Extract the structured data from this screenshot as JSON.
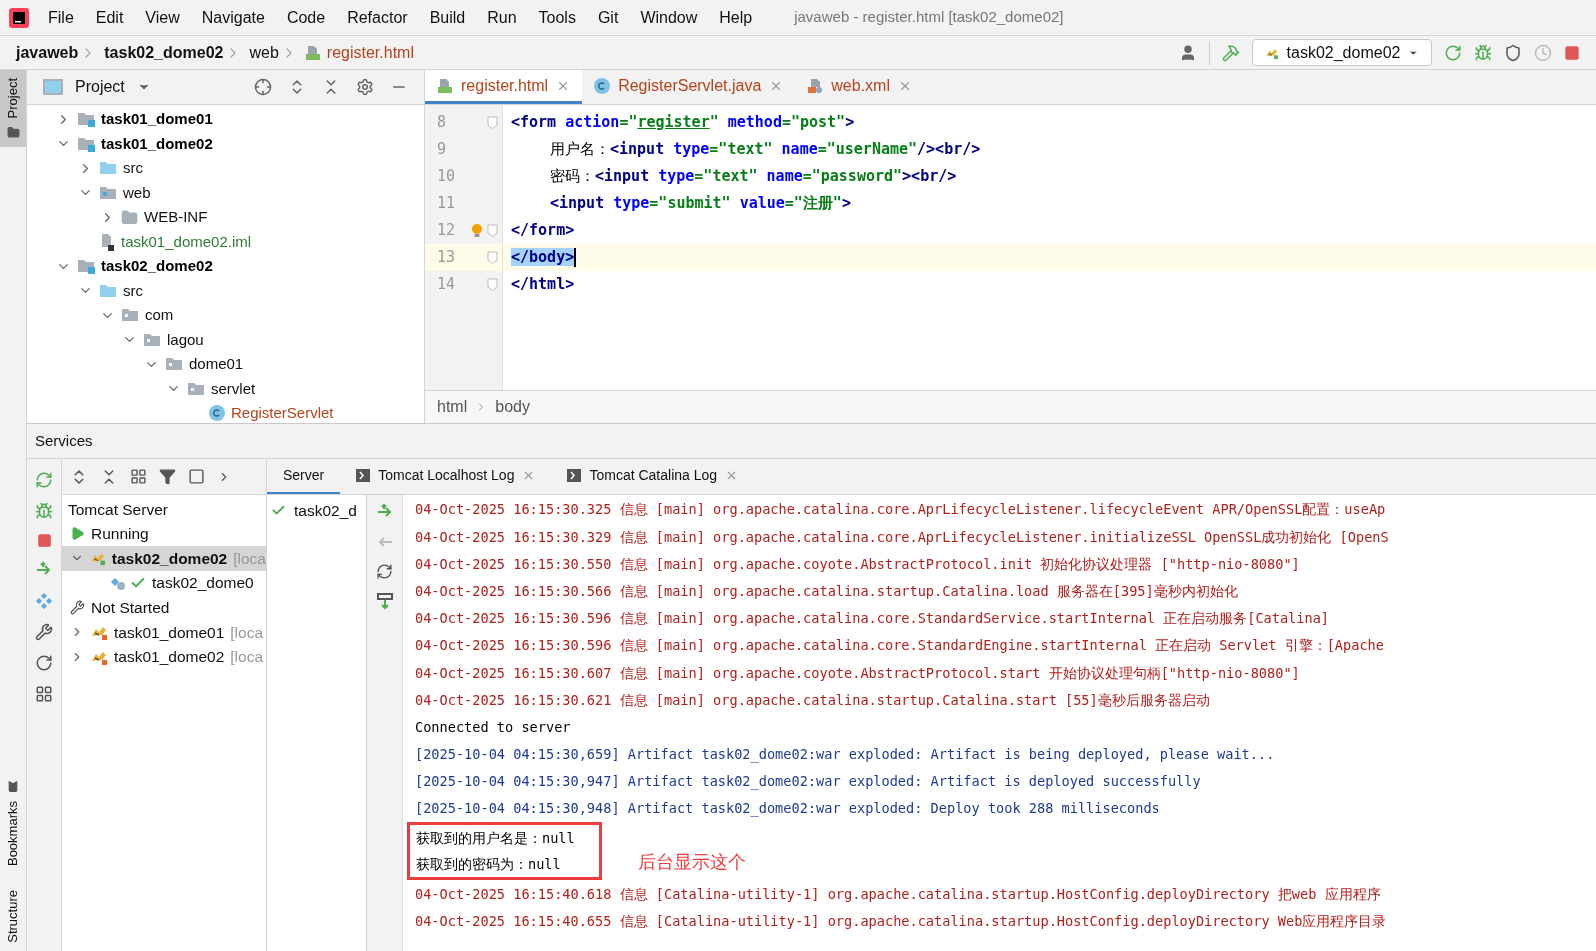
{
  "menu": [
    "File",
    "Edit",
    "View",
    "Navigate",
    "Code",
    "Refactor",
    "Build",
    "Run",
    "Tools",
    "Git",
    "Window",
    "Help"
  ],
  "window": {
    "title": "javaweb - register.html [task02_dome02]"
  },
  "breadcrumb": [
    {
      "label": "javaweb",
      "bold": true
    },
    {
      "label": "task02_dome02",
      "bold": true
    },
    {
      "label": "web",
      "bold": false
    },
    {
      "label": "register.html",
      "bold": false,
      "file": true
    }
  ],
  "run_config": {
    "label": "task02_dome02"
  },
  "side_tabs": {
    "top": "Project",
    "bottom": [
      "Bookmarks",
      "Structure"
    ]
  },
  "project": {
    "title": "Project",
    "tree": [
      {
        "label": "task01_dome01",
        "kind": "module",
        "bold": true,
        "expanded": false
      },
      {
        "label": "task01_dome02",
        "kind": "module",
        "bold": true,
        "expanded": true,
        "children": [
          {
            "label": "src",
            "kind": "source",
            "expanded": false
          },
          {
            "label": "web",
            "kind": "web",
            "expanded": true,
            "children": [
              {
                "label": "WEB-INF",
                "kind": "folder",
                "expanded": false
              }
            ]
          },
          {
            "label": "task01_dome02.iml",
            "kind": "iml",
            "color": "#2e7d32"
          }
        ]
      },
      {
        "label": "task02_dome02",
        "kind": "module",
        "bold": true,
        "expanded": true,
        "children": [
          {
            "label": "src",
            "kind": "source",
            "expanded": true,
            "children": [
              {
                "label": "com",
                "kind": "package",
                "expanded": true,
                "children": [
                  {
                    "label": "lagou",
                    "kind": "package",
                    "expanded": true,
                    "children": [
                      {
                        "label": "dome01",
                        "kind": "package",
                        "expanded": true,
                        "children": [
                          {
                            "label": "servlet",
                            "kind": "package",
                            "expanded": true,
                            "children": [
                              {
                                "label": "RegisterServlet",
                                "kind": "class",
                                "color": "#b5441b"
                              }
                            ]
                          }
                        ]
                      }
                    ]
                  }
                ]
              }
            ]
          }
        ]
      }
    ]
  },
  "editor": {
    "tabs": [
      {
        "label": "register.html",
        "kind": "html",
        "selected": true
      },
      {
        "label": "RegisterServlet.java",
        "kind": "class",
        "selected": false
      },
      {
        "label": "web.xml",
        "kind": "xml",
        "selected": false
      }
    ],
    "lines": [
      {
        "number": "8",
        "current": false,
        "fold": true,
        "indent": false,
        "tokens": [
          {
            "text": "<",
            "kind": "punct"
          },
          {
            "text": "form",
            "kind": "tag"
          },
          {
            "text": " action",
            "kind": "attr"
          },
          {
            "text": "=\"",
            "kind": "value"
          },
          {
            "text": "register",
            "kind": "link"
          },
          {
            "text": "\"",
            "kind": "value"
          },
          {
            "text": " method",
            "kind": "attr"
          },
          {
            "text": "=\"post\"",
            "kind": "value"
          },
          {
            "text": ">",
            "kind": "punct"
          }
        ]
      },
      {
        "number": "9",
        "current": false,
        "fold": false,
        "indent": true,
        "tokens": [
          {
            "text": "用户名：",
            "kind": "plain"
          },
          {
            "text": "<",
            "kind": "punct"
          },
          {
            "text": "input",
            "kind": "tag"
          },
          {
            "text": " type",
            "kind": "attr"
          },
          {
            "text": "=\"text\"",
            "kind": "value"
          },
          {
            "text": " name",
            "kind": "attr"
          },
          {
            "text": "=\"userName\"",
            "kind": "value"
          },
          {
            "text": "/><",
            "kind": "punct"
          },
          {
            "text": "br",
            "kind": "tag"
          },
          {
            "text": "/>",
            "kind": "punct"
          }
        ]
      },
      {
        "number": "10",
        "current": false,
        "fold": false,
        "indent": true,
        "tokens": [
          {
            "text": "密码：",
            "kind": "plain"
          },
          {
            "text": "<",
            "kind": "punct"
          },
          {
            "text": "input",
            "kind": "tag"
          },
          {
            "text": " type",
            "kind": "attr"
          },
          {
            "text": "=\"text\"",
            "kind": "value"
          },
          {
            "text": " name",
            "kind": "attr"
          },
          {
            "text": "=\"password\"",
            "kind": "value"
          },
          {
            "text": "><",
            "kind": "punct"
          },
          {
            "text": "br",
            "kind": "tag"
          },
          {
            "text": "/>",
            "kind": "punct"
          }
        ]
      },
      {
        "number": "11",
        "current": false,
        "fold": false,
        "indent": true,
        "tokens": [
          {
            "text": "<",
            "kind": "punct"
          },
          {
            "text": "input",
            "kind": "tag"
          },
          {
            "text": " type",
            "kind": "attr"
          },
          {
            "text": "=\"submit\"",
            "kind": "value"
          },
          {
            "text": " value",
            "kind": "attr"
          },
          {
            "text": "=\"注册\"",
            "kind": "value"
          },
          {
            "text": ">",
            "kind": "punct"
          }
        ]
      },
      {
        "number": "12",
        "current": false,
        "fold": true,
        "indent": false,
        "bulb": true,
        "tokens": [
          {
            "text": "</",
            "kind": "punct"
          },
          {
            "text": "form",
            "kind": "tag"
          },
          {
            "text": ">",
            "kind": "punct"
          }
        ]
      },
      {
        "number": "13",
        "current": true,
        "fold": true,
        "indent": false,
        "tokens": [
          {
            "text": "</body>",
            "kind": "selected"
          }
        ]
      },
      {
        "number": "14",
        "current": false,
        "fold": true,
        "indent": false,
        "tokens": [
          {
            "text": "</",
            "kind": "punct"
          },
          {
            "text": "html",
            "kind": "tag"
          },
          {
            "text": ">",
            "kind": "punct"
          }
        ]
      }
    ],
    "path": [
      "html",
      "body"
    ]
  },
  "services": {
    "title": "Services",
    "tree": [
      {
        "label": "Tomcat Server",
        "kind": "root",
        "selected": false
      },
      {
        "label": "Running",
        "kind": "running",
        "selected": false
      },
      {
        "label": "task02_dome02",
        "location": "[loca",
        "kind": "server-running",
        "expanded": true,
        "selected": true
      },
      {
        "label": "task02_dome0",
        "kind": "artifact",
        "selected": false
      },
      {
        "label": "Not Started",
        "kind": "stopped",
        "selected": false
      },
      {
        "label": "task01_dome01",
        "location": "[loca",
        "kind": "server",
        "expanded": false,
        "selected": false
      },
      {
        "label": "task01_dome02",
        "location": "[loca",
        "kind": "server",
        "expanded": false,
        "selected": false
      }
    ],
    "tabs": [
      {
        "label": "Server",
        "selected": true,
        "closable": false
      },
      {
        "label": "Tomcat Localhost Log",
        "selected": false,
        "closable": true
      },
      {
        "label": "Tomcat Catalina Log",
        "selected": false,
        "closable": true
      }
    ],
    "deployment": {
      "label": "task02_d"
    },
    "console": [
      {
        "kind": "info",
        "text": "04-Oct-2025 16:15:30.325 信息 [main] org.apache.catalina.core.AprLifecycleListener.lifecycleEvent APR/OpenSSL配置：useAp"
      },
      {
        "kind": "info",
        "text": "04-Oct-2025 16:15:30.329 信息 [main] org.apache.catalina.core.AprLifecycleListener.initializeSSL OpenSSL成功初始化 [OpenS"
      },
      {
        "kind": "info",
        "text": "04-Oct-2025 16:15:30.550 信息 [main] org.apache.coyote.AbstractProtocol.init 初始化协议处理器 [\"http-nio-8080\"]"
      },
      {
        "kind": "info",
        "text": "04-Oct-2025 16:15:30.566 信息 [main] org.apache.catalina.startup.Catalina.load 服务器在[395]毫秒内初始化"
      },
      {
        "kind": "info",
        "text": "04-Oct-2025 16:15:30.596 信息 [main] org.apache.catalina.core.StandardService.startInternal 正在启动服务[Catalina]"
      },
      {
        "kind": "info",
        "text": "04-Oct-2025 16:15:30.596 信息 [main] org.apache.catalina.core.StandardEngine.startInternal 正在启动 Servlet 引擎：[Apache"
      },
      {
        "kind": "info",
        "text": "04-Oct-2025 16:15:30.607 信息 [main] org.apache.coyote.AbstractProtocol.start 开始协议处理句柄[\"http-nio-8080\"]"
      },
      {
        "kind": "info",
        "text": "04-Oct-2025 16:15:30.621 信息 [main] org.apache.catalina.startup.Catalina.start [55]毫秒后服务器启动"
      },
      {
        "kind": "plain",
        "text": "Connected to server"
      },
      {
        "kind": "artifact",
        "text": "[2025-10-04 04:15:30,659] Artifact task02_dome02:war exploded: Artifact is being deployed, please wait..."
      },
      {
        "kind": "artifact",
        "text": "[2025-10-04 04:15:30,947] Artifact task02_dome02:war exploded: Artifact is deployed successfully"
      },
      {
        "kind": "artifact",
        "text": "[2025-10-04 04:15:30,948] Artifact task02_dome02:war exploded: Deploy took 288 milliseconds"
      },
      {
        "kind": "highlighted",
        "lines": [
          "获取到的用户名是：null",
          "获取到的密码为：null"
        ],
        "note": "后台显示这个"
      },
      {
        "kind": "info",
        "text": "04-Oct-2025 16:15:40.618 信息 [Catalina-utility-1] org.apache.catalina.startup.HostConfig.deployDirectory 把web 应用程序"
      },
      {
        "kind": "info",
        "text": "04-Oct-2025 16:15:40.655 信息 [Catalina-utility-1] org.apache.catalina.startup.HostConfig.deployDirectory Web应用程序目录"
      }
    ]
  }
}
